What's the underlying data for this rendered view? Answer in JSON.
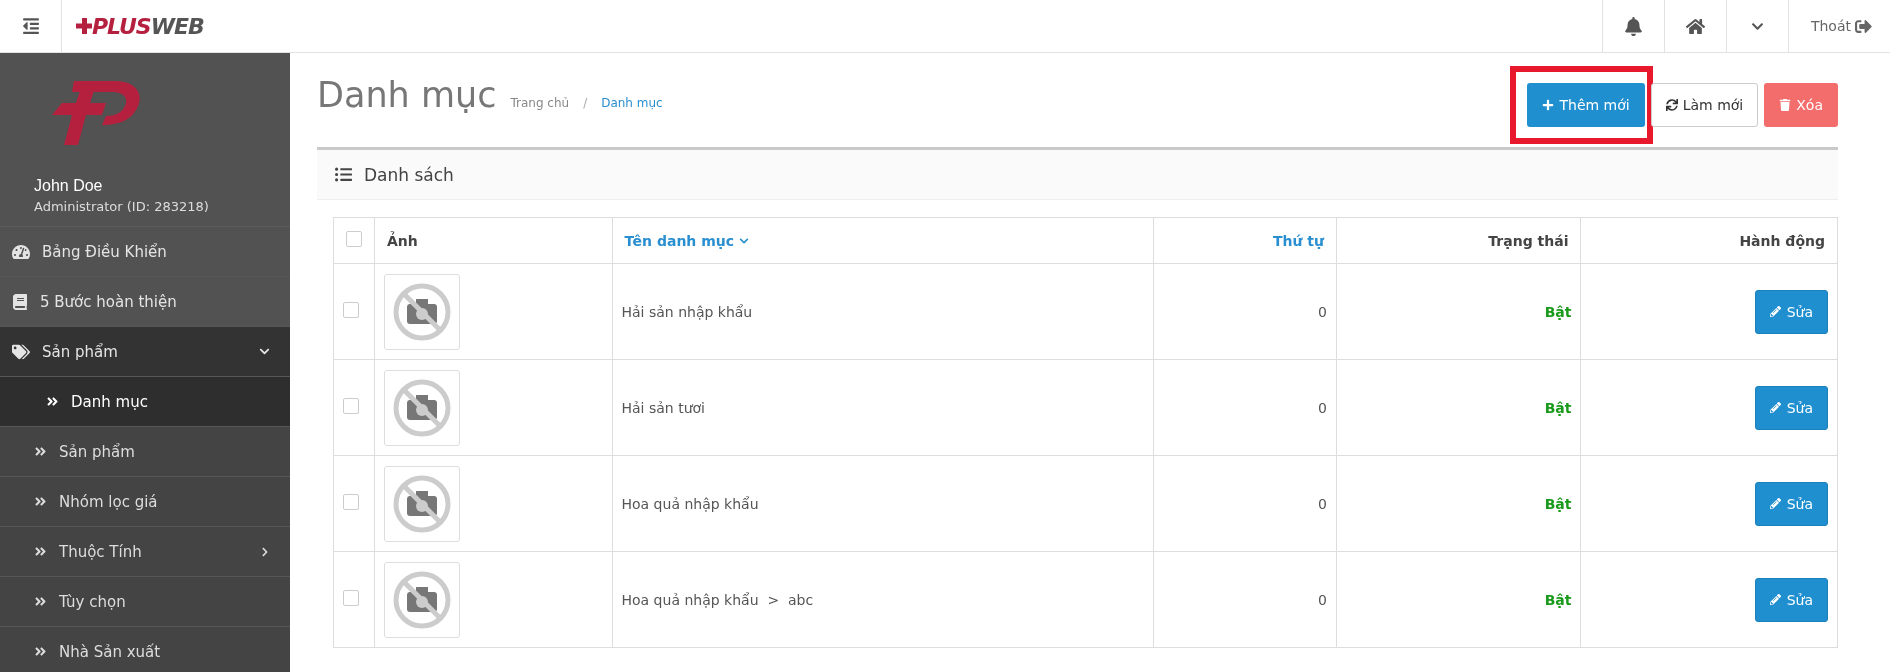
{
  "topbar": {
    "logo": {
      "red": "PLUS",
      "gray": "WEB"
    },
    "logout": "Thoát"
  },
  "sidebar": {
    "user": {
      "name": "John Doe",
      "role": "Administrator (ID: 283218)"
    },
    "items": [
      {
        "kind": "gauge",
        "label": "Bảng Điều Khiển",
        "selected": false,
        "expanded": false
      },
      {
        "kind": "book",
        "label": "5 Bước hoàn thiện",
        "selected": false,
        "expanded": false
      },
      {
        "kind": "tags",
        "label": "Sản phẩm",
        "selected": false,
        "expanded": true,
        "children": [
          {
            "label": "Danh mục",
            "selected": true,
            "has_children": false
          },
          {
            "label": "Sản phẩm",
            "selected": false,
            "has_children": false
          },
          {
            "label": "Nhóm lọc giá",
            "selected": false,
            "has_children": false
          },
          {
            "label": "Thuộc Tính",
            "selected": false,
            "has_children": true
          },
          {
            "label": "Tùy chọn",
            "selected": false,
            "has_children": false
          },
          {
            "label": "Nhà Sản xuất",
            "selected": false,
            "has_children": false
          }
        ]
      }
    ]
  },
  "page": {
    "title": "Danh mục",
    "breadcrumb": [
      {
        "label": "Trang chủ",
        "selected": false
      },
      {
        "label": "Danh mục",
        "selected": true
      }
    ],
    "breadcrumb_separator": "/",
    "actions": [
      {
        "kind": "add",
        "label": "Thêm mới",
        "highlighted": true
      },
      {
        "kind": "refresh",
        "label": "Làm mới",
        "highlighted": false
      },
      {
        "kind": "delete",
        "label": "Xóa",
        "highlighted": false
      }
    ]
  },
  "panel": {
    "title": "Danh sách",
    "table": {
      "select_all_checked": false,
      "columns": [
        {
          "label": "Ảnh",
          "sortable": false,
          "sorted": false
        },
        {
          "label": "Tên danh mục",
          "sortable": true,
          "sorted": true
        },
        {
          "label": "Thứ tự",
          "sortable": true,
          "sorted": false
        },
        {
          "label": "Trạng thái",
          "sortable": false,
          "sorted": false
        },
        {
          "label": "Hành động",
          "sortable": false,
          "sorted": false
        }
      ],
      "rows": [
        {
          "checked": false,
          "name": "Hải sản nhập khẩu",
          "order": "0",
          "status": "Bật",
          "action": "Sửa"
        },
        {
          "checked": false,
          "name": "Hải sản tươi",
          "order": "0",
          "status": "Bật",
          "action": "Sửa"
        },
        {
          "checked": false,
          "name": "Hoa quả nhập khẩu",
          "order": "0",
          "status": "Bật",
          "action": "Sửa"
        },
        {
          "checked": false,
          "name": "Hoa quả nhập khẩu  >  abc",
          "order": "0",
          "status": "Bật",
          "action": "Sửa"
        }
      ]
    }
  }
}
